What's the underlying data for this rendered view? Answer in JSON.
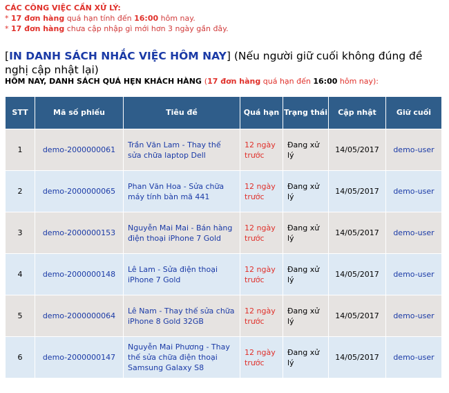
{
  "alerts": {
    "title": "CÁC CÔNG VIỆC CẦN XỬ LÝ:",
    "line1": {
      "bullet": "* ",
      "count": "17 đơn hàng",
      "text": " quá hạn tính đến ",
      "time": "16:00",
      "suffix": " hôm nay."
    },
    "line2": {
      "bullet": "* ",
      "count": "17 đơn hàng",
      "text": " chưa cập nhập gì mới hơn 3 ngày gần đây."
    }
  },
  "heading": {
    "open": "[",
    "link": "IN DANH SÁCH NHẮC VIỆC HÔM NAY",
    "close": "]",
    "note": " (Nếu người giữ cuối không đúng đề nghị cập nhật lại)"
  },
  "sub": {
    "text": "HÔM NAY, DANH SÁCH QUÁ HẸN KHÁCH HÀNG ",
    "open": "(",
    "count": "17 đơn hàng",
    "mid": " quá hạn đến ",
    "time": "16:00",
    "end": " hôm nay",
    "close": "):"
  },
  "table": {
    "headers": [
      "STT",
      "Mã số phiếu",
      "Tiêu đề",
      "Quá hạn",
      "Trạng thái",
      "Cập nhật",
      "Giữ cuối"
    ],
    "rows": [
      {
        "stt": "1",
        "code": "demo-2000000061",
        "title": "Trần Văn Lam - Thay thế sửa chữa laptop Dell",
        "overdue": "12 ngày trước",
        "status": "Đang xử lý",
        "updated": "14/05/2017",
        "holder": "demo-user"
      },
      {
        "stt": "2",
        "code": "demo-2000000065",
        "title": "Phan Văn Hoa - Sửa chữa máy tính bàn mã 441",
        "overdue": "12 ngày trước",
        "status": "Đang xử lý",
        "updated": "14/05/2017",
        "holder": "demo-user"
      },
      {
        "stt": "3",
        "code": "demo-2000000153",
        "title": "Nguyễn Mai Mai - Bán hàng điện thoại iPhone 7 Gold",
        "overdue": "12 ngày trước",
        "status": "Đang xử lý",
        "updated": "14/05/2017",
        "holder": "demo-user"
      },
      {
        "stt": "4",
        "code": "demo-2000000148",
        "title": "Lê Lam - Sửa điện thoại iPhone 7 Gold",
        "overdue": "12 ngày trước",
        "status": "Đang xử lý",
        "updated": "14/05/2017",
        "holder": "demo-user"
      },
      {
        "stt": "5",
        "code": "demo-2000000064",
        "title": "Lê Nam - Thay thế sửa chữa iPhone 8 Gold 32GB",
        "overdue": "12 ngày trước",
        "status": "Đang xử lý",
        "updated": "14/05/2017",
        "holder": "demo-user"
      },
      {
        "stt": "6",
        "code": "demo-2000000147",
        "title": "Nguyễn Mai Phương - Thay thế sửa chữa điện thoại Samsung Galaxy S8",
        "overdue": "12 ngày trước",
        "status": "Đang xử lý",
        "updated": "14/05/2017",
        "holder": "demo-user"
      }
    ]
  }
}
